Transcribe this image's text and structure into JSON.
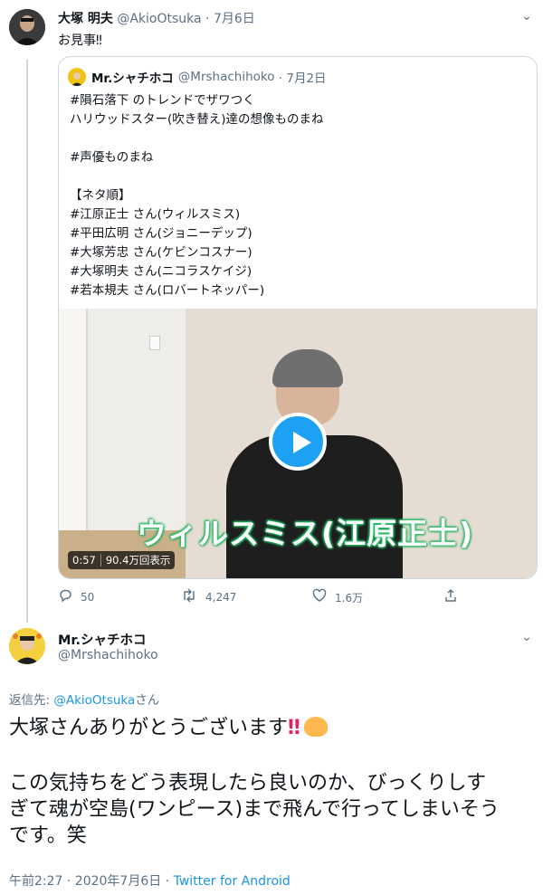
{
  "tweet1": {
    "display_name": "大塚 明夫",
    "handle": "@AkioOtsuka",
    "date": "· 7月6日",
    "text": "お見事‼",
    "stats": {
      "replies": "50",
      "retweets": "4,247",
      "likes": "1.6万"
    }
  },
  "quote": {
    "display_name": "Mr.シャチホコ",
    "handle": "@Mrshachihoko",
    "date": "· 7月2日",
    "lines": [
      "#隕石落下 のトレンドでザワつく",
      "ハリウッドスター(吹き替え)達の想像ものまね",
      "",
      "#声優ものまね",
      "",
      "【ネタ順】",
      "#江原正士 さん(ウィルスミス)",
      "#平田広明 さん(ジョニーデップ)",
      "#大塚芳忠 さん(ケビンコスナー)",
      "#大塚明夫 さん(ニコラスケイジ)",
      "#若本規夫 さん(ロバートネッパー)"
    ],
    "video": {
      "caption": "ウィルスミス(江原正士)",
      "duration": "0:57",
      "views": "90.4万回表示"
    }
  },
  "tweet2": {
    "display_name": "Mr.シャチホコ",
    "handle": "@Mrshachihoko",
    "reply_label": "返信先: ",
    "reply_handle": "@AkioOtsuka",
    "reply_suffix": "さん",
    "line1": "大塚さんありがとうございます",
    "line1_mark": "‼",
    "line2": "この気持ちをどう表現したら良いのか、びっくりしす",
    "line3": "ぎて魂が空島(ワンピース)まで飛んで行ってしまいそう",
    "line4": "です。笑",
    "timestamp": "午前2:27 · 2020年7月6日 · ",
    "source": "Twitter for Android"
  },
  "icons": {
    "caret": "chevron-down-icon",
    "reply": "reply-icon",
    "retweet": "retweet-icon",
    "like": "like-icon",
    "share": "share-icon",
    "play": "play-icon"
  },
  "colors": {
    "link": "#1b95e0",
    "play_button": "#1da1f2",
    "muted": "#5b7083"
  }
}
